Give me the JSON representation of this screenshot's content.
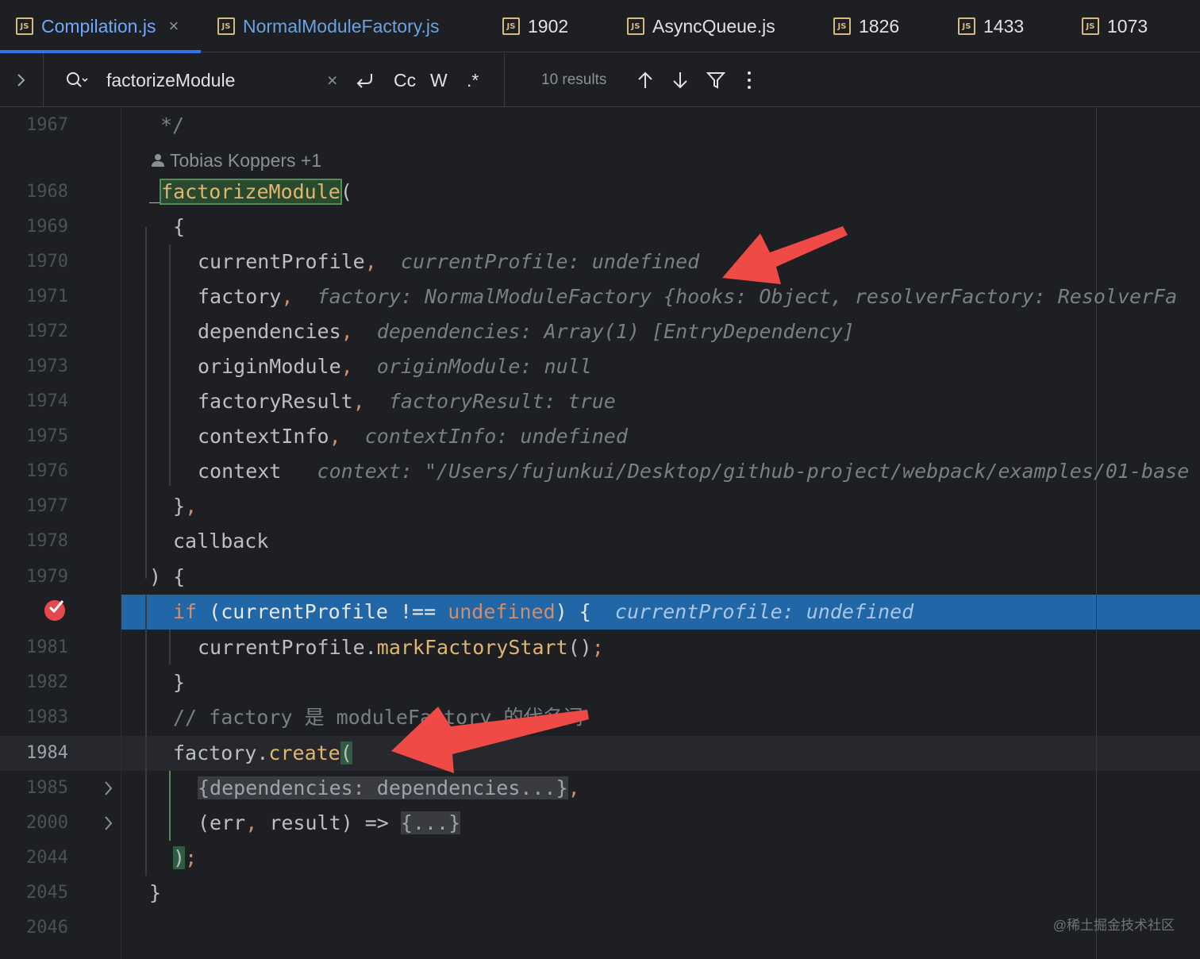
{
  "tabs": [
    {
      "label": "Compilation.js",
      "icon": "js-file-icon",
      "active": true
    },
    {
      "label": "NormalModuleFactory.js",
      "icon": "js-file-icon"
    },
    {
      "label": "1902",
      "icon": "js-file-icon"
    },
    {
      "label": "AsyncQueue.js",
      "icon": "js-file-icon"
    },
    {
      "label": "1826",
      "icon": "js-file-icon"
    },
    {
      "label": "1433",
      "icon": "js-file-icon"
    },
    {
      "label": "1073",
      "icon": "js-file-icon"
    }
  ],
  "search": {
    "query": "factorizeModule",
    "results": "10 results",
    "match_case": "Cc",
    "words": "W",
    "regex": ".*"
  },
  "author": "Tobias Koppers +1",
  "lines": {
    "l1967": "1967",
    "l1968": "1968",
    "l1969": "1969",
    "l1970": "1970",
    "l1971": "1971",
    "l1972": "1972",
    "l1973": "1973",
    "l1974": "1974",
    "l1975": "1975",
    "l1976": "1976",
    "l1977": "1977",
    "l1978": "1978",
    "l1979": "1979",
    "l1981": "1981",
    "l1982": "1982",
    "l1983": "1983",
    "l1984": "1984",
    "l1985": "1985",
    "l2000": "2000",
    "l2044": "2044",
    "l2045": "2045",
    "l2046": "2046"
  },
  "code": {
    "c1967": "*/",
    "c1968_pre": "_",
    "c1968_match": "factorizeModule",
    "c1968_post": "(",
    "c1969": "{",
    "c1970": "currentProfile",
    "h1970": "currentProfile: undefined",
    "c1971": "factory",
    "h1971": "factory: NormalModuleFactory {hooks: Object, resolverFactory: ResolverFa",
    "c1972": "dependencies",
    "h1972": "dependencies: Array(1) [EntryDependency]",
    "c1973": "originModule",
    "h1973": "originModule: null",
    "c1974": "factoryResult",
    "h1974": "factoryResult: true",
    "c1975": "contextInfo",
    "h1975": "contextInfo: undefined",
    "c1976": "context",
    "h1976": "context: \"/Users/fujunkui/Desktop/github-project/webpack/examples/01-base",
    "c1977": "}",
    "c1978": "callback",
    "c1979": ") {",
    "c1980_if": "if",
    "c1980_a": " (currentProfile !== ",
    "c1980_undef": "undefined",
    "c1980_b": ") {",
    "h1980": "currentProfile: undefined",
    "c1981_obj": "currentProfile.",
    "c1981_fn": "markFactoryStart",
    "c1981_end": "()",
    "c1982": "}",
    "c1983": "// factory 是 moduleFactory 的代名词",
    "c1984_obj": "factory.",
    "c1984_fn": "create",
    "c1984_paren": "(",
    "c1985_fold": "{dependencies: dependencies...}",
    "c2000_a": "(err",
    "c2000_b": " result) => ",
    "c2000_fold": "{...}",
    "c2044_paren": ")",
    "c2045": "}"
  },
  "watermark": "@稀土掘金技术社区",
  "colors": {
    "background": "#1e1f22",
    "exec_line": "#2166a6",
    "arrow": "#f04a47",
    "keyword": "#cf8e6d",
    "function": "#e0b66e",
    "hint": "#7a7e85"
  }
}
